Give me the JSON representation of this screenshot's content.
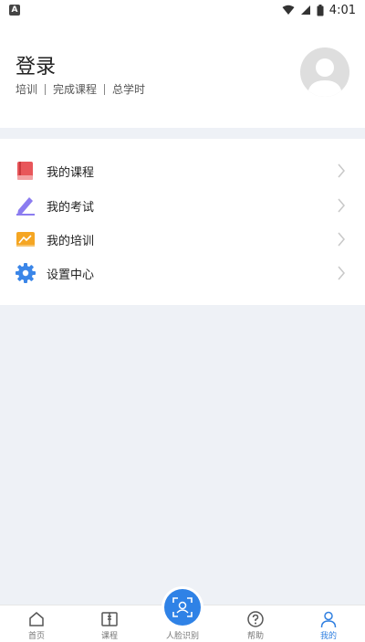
{
  "status_bar": {
    "time": "4:01",
    "app_icon_letter": "A"
  },
  "header": {
    "title": "登录",
    "stats": [
      "培训",
      "完成课程",
      "总学时"
    ]
  },
  "menu": {
    "items": [
      {
        "label": "我的课程",
        "icon": "book-icon",
        "color": "#e8565a"
      },
      {
        "label": "我的考试",
        "icon": "pencil-icon",
        "color": "#8b7cf0"
      },
      {
        "label": "我的培训",
        "icon": "training-icon",
        "color": "#f5a623"
      },
      {
        "label": "设置中心",
        "icon": "gear-icon",
        "color": "#3b86e8"
      }
    ]
  },
  "tabbar": {
    "items": [
      {
        "label": "首页",
        "icon": "home-icon"
      },
      {
        "label": "课程",
        "icon": "course-icon"
      },
      {
        "label": "人脸识别",
        "icon": "face-scan-icon"
      },
      {
        "label": "帮助",
        "icon": "help-icon"
      },
      {
        "label": "我的",
        "icon": "profile-icon",
        "active": true
      }
    ]
  },
  "colors": {
    "accent": "#2f7fe0",
    "background": "#eef1f6"
  }
}
